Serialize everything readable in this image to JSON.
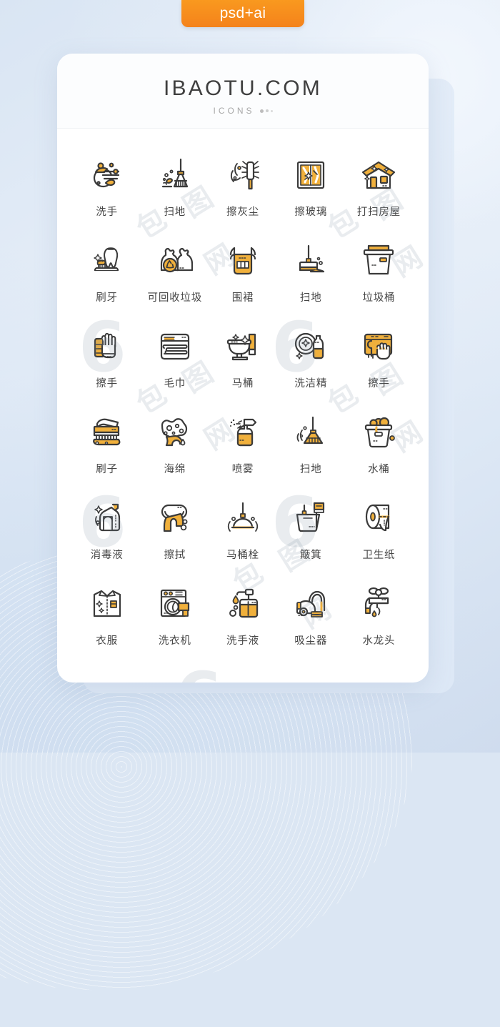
{
  "badge": {
    "label": "psd+ai",
    "color": "#F4821B"
  },
  "card": {
    "title": "IBAOTU.COM",
    "subtitle": "ICONS",
    "accent_yellow": "#F0B03C",
    "stroke_dark": "#3A3A3A",
    "label_color": "#454545",
    "background": "#FFFFFF"
  },
  "page_background": {
    "from": "#D9E5F3",
    "to": "#CFDCEE"
  },
  "watermark": {
    "mark_1": "6",
    "mark_2": "包",
    "mark_3": "图",
    "mark_4": "网"
  },
  "icons": [
    {
      "label": "洗手",
      "name": "wash-hands-icon"
    },
    {
      "label": "扫地",
      "name": "sweep-floor-broom-icon"
    },
    {
      "label": "擦灰尘",
      "name": "dust-brush-icon"
    },
    {
      "label": "擦玻璃",
      "name": "clean-window-icon"
    },
    {
      "label": "打扫房屋",
      "name": "clean-house-icon"
    },
    {
      "label": "刷牙",
      "name": "brush-teeth-icon"
    },
    {
      "label": "可回收垃圾",
      "name": "recyclable-trash-bags-icon"
    },
    {
      "label": "围裙",
      "name": "apron-icon"
    },
    {
      "label": "扫地",
      "name": "floor-squeegee-icon"
    },
    {
      "label": "垃圾桶",
      "name": "trash-bin-icon"
    },
    {
      "label": "擦手",
      "name": "cleaning-gloves-icon"
    },
    {
      "label": "毛巾",
      "name": "towel-icon"
    },
    {
      "label": "马桶",
      "name": "toilet-icon"
    },
    {
      "label": "洗洁精",
      "name": "dish-soap-icon"
    },
    {
      "label": "擦手",
      "name": "wipe-hand-cloth-icon"
    },
    {
      "label": "刷子",
      "name": "scrub-brush-icon"
    },
    {
      "label": "海绵",
      "name": "sponge-icon"
    },
    {
      "label": "喷雾",
      "name": "spray-bottle-icon"
    },
    {
      "label": "扫地",
      "name": "broom-sweeping-icon"
    },
    {
      "label": "水桶",
      "name": "water-bucket-icon"
    },
    {
      "label": "消毒液",
      "name": "disinfectant-icon"
    },
    {
      "label": "擦拭",
      "name": "wipe-cloth-icon"
    },
    {
      "label": "马桶栓",
      "name": "toilet-plunger-icon"
    },
    {
      "label": "簸箕",
      "name": "dustpan-icon"
    },
    {
      "label": "卫生纸",
      "name": "toilet-paper-icon"
    },
    {
      "label": "衣服",
      "name": "shirt-icon"
    },
    {
      "label": "洗衣机",
      "name": "washing-machine-icon"
    },
    {
      "label": "洗手液",
      "name": "hand-soap-dispenser-icon"
    },
    {
      "label": "吸尘器",
      "name": "vacuum-cleaner-icon"
    },
    {
      "label": "水龙头",
      "name": "faucet-icon"
    }
  ]
}
